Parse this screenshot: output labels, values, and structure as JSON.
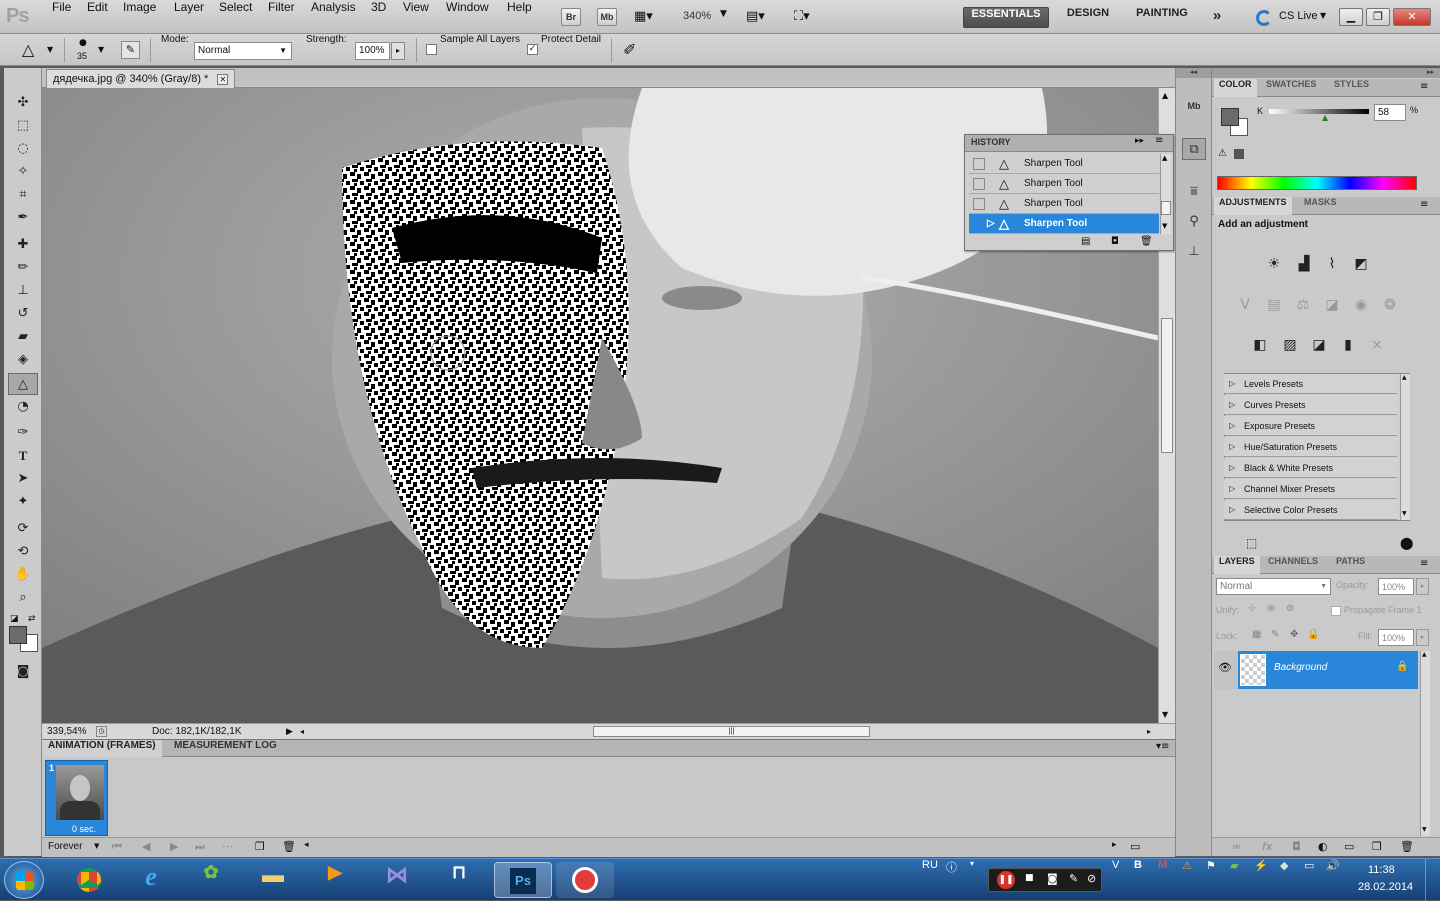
{
  "app": {
    "logo": "Ps"
  },
  "menu": [
    "File",
    "Edit",
    "Image",
    "Layer",
    "Select",
    "Filter",
    "Analysis",
    "3D",
    "View",
    "Window",
    "Help"
  ],
  "appbar": {
    "br": "Br",
    "mb": "Mb",
    "zoom": "340%",
    "workspaces": [
      "ESSENTIALS",
      "DESIGN",
      "PAINTING"
    ],
    "more": "»",
    "cslive": "CS Live"
  },
  "options": {
    "brush_size": "35",
    "mode_label": "Mode:",
    "mode_value": "Normal",
    "strength_label": "Strength:",
    "strength_value": "100%",
    "sample_all_layers": "Sample All Layers",
    "protect_detail": "Protect Detail"
  },
  "document": {
    "tab_title": "дядечка.jpg @ 340% (Gray/8) *",
    "zoom_status": "339,54%",
    "doc_info": "Doc: 182,1K/182,1K"
  },
  "history": {
    "title": "HISTORY",
    "items": [
      "Sharpen Tool",
      "Sharpen Tool",
      "Sharpen Tool",
      "Sharpen Tool"
    ]
  },
  "color_panel": {
    "tabs": [
      "COLOR",
      "SWATCHES",
      "STYLES"
    ],
    "k_label": "K",
    "k_value": "58",
    "pct": "%"
  },
  "adjustments": {
    "tabs": [
      "ADJUSTMENTS",
      "MASKS"
    ],
    "heading": "Add an adjustment",
    "presets": [
      "Levels Presets",
      "Curves Presets",
      "Exposure Presets",
      "Hue/Saturation Presets",
      "Black & White Presets",
      "Channel Mixer Presets",
      "Selective Color Presets"
    ]
  },
  "layers": {
    "tabs": [
      "LAYERS",
      "CHANNELS",
      "PATHS"
    ],
    "blend": "Normal",
    "opacity_label": "Opacity:",
    "opacity_value": "100%",
    "unify_label": "Unify:",
    "propagate": "Propagate Frame 1",
    "lock_label": "Lock:",
    "fill_label": "Fill:",
    "fill_value": "100%",
    "layer_name": "Background"
  },
  "animation": {
    "tabs": [
      "ANIMATION (FRAMES)",
      "MEASUREMENT LOG"
    ],
    "frame_number": "1",
    "frame_delay": "0 sec.",
    "loop": "Forever"
  },
  "taskbar": {
    "lang": "RU",
    "time": "11:38",
    "date": "28.02.2014"
  }
}
